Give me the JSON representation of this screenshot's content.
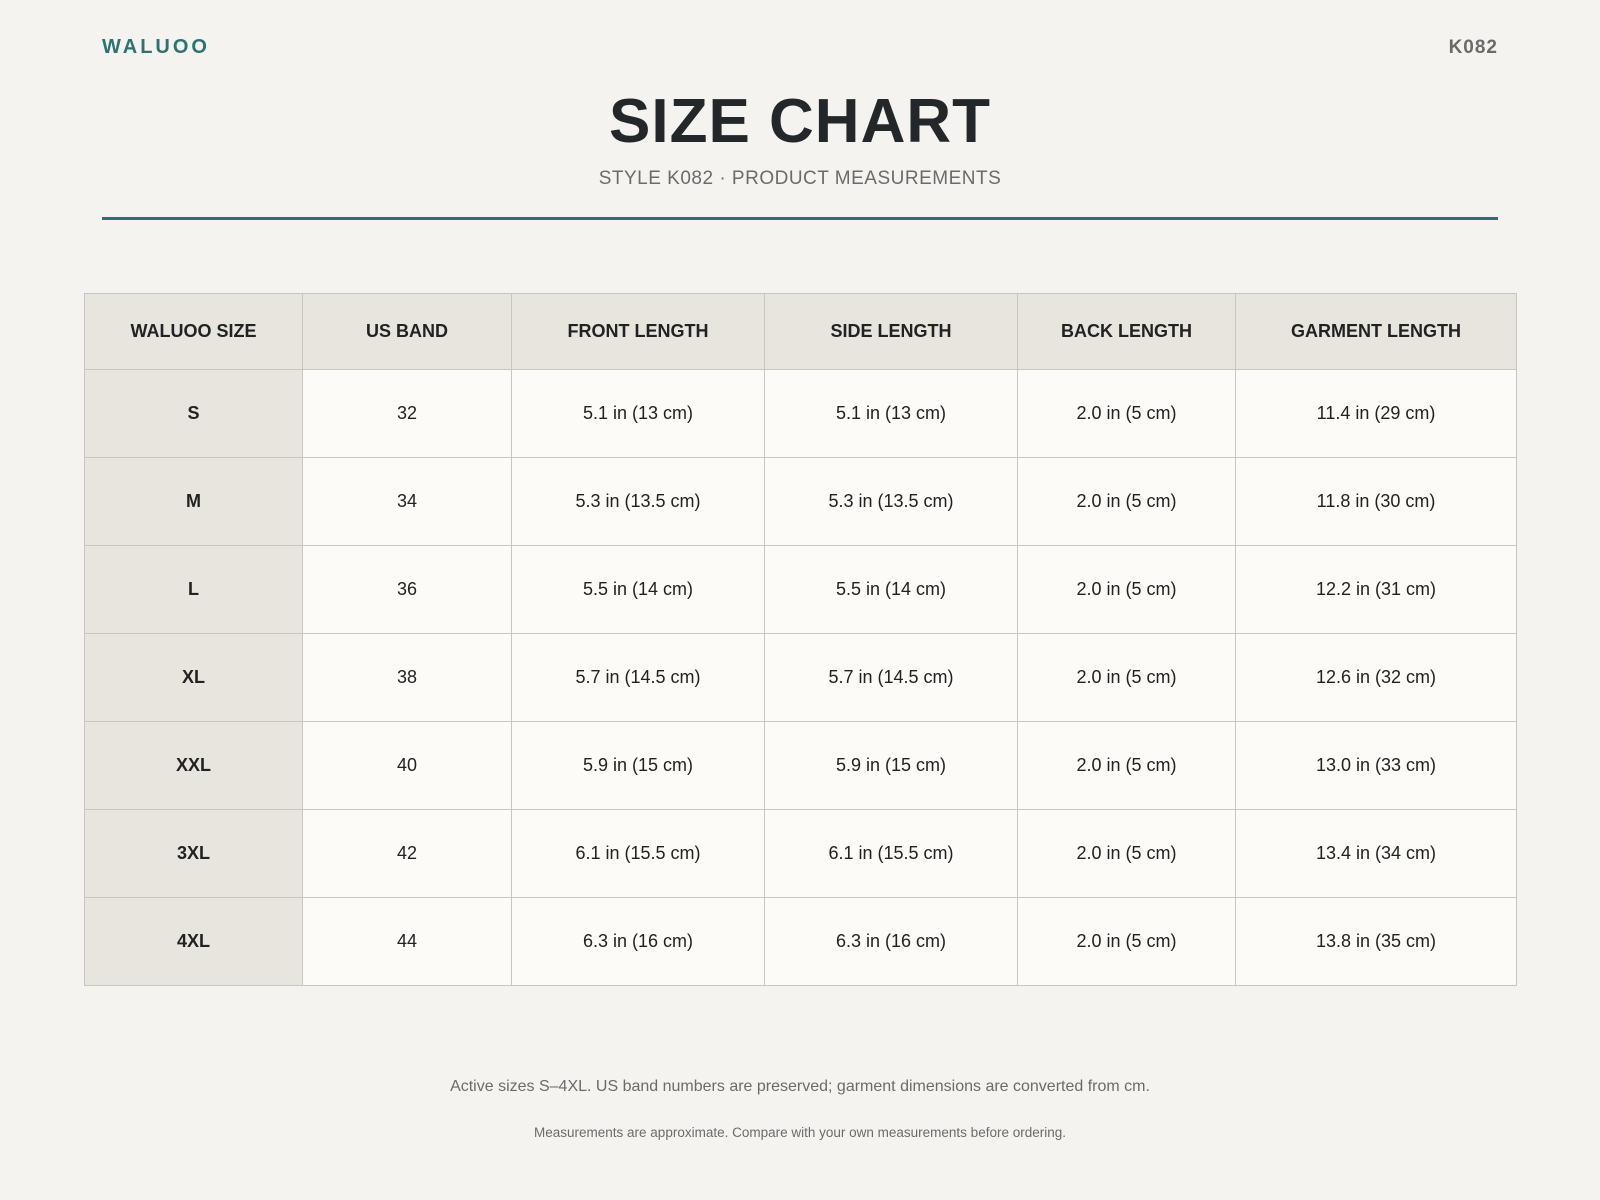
{
  "header": {
    "brand": "WALUOO",
    "code": "K082",
    "title": "SIZE CHART",
    "subtitle": "STYLE K082 · PRODUCT MEASUREMENTS"
  },
  "colors": {
    "accent": "#2f6e6e",
    "background": "#f4f3ef",
    "header_cell": "#e8e5df"
  },
  "table": {
    "columns": [
      "WALUOO SIZE",
      "US BAND",
      "FRONT LENGTH",
      "SIDE LENGTH",
      "BACK LENGTH",
      "GARMENT LENGTH"
    ],
    "rows": [
      [
        "S",
        "32",
        "5.1 in (13 cm)",
        "5.1 in (13 cm)",
        "2.0 in (5 cm)",
        "11.4 in (29 cm)"
      ],
      [
        "M",
        "34",
        "5.3 in (13.5 cm)",
        "5.3 in (13.5 cm)",
        "2.0 in (5 cm)",
        "11.8 in (30 cm)"
      ],
      [
        "L",
        "36",
        "5.5 in (14 cm)",
        "5.5 in (14 cm)",
        "2.0 in (5 cm)",
        "12.2 in (31 cm)"
      ],
      [
        "XL",
        "38",
        "5.7 in (14.5 cm)",
        "5.7 in (14.5 cm)",
        "2.0 in (5 cm)",
        "12.6 in (32 cm)"
      ],
      [
        "XXL",
        "40",
        "5.9 in (15 cm)",
        "5.9 in (15 cm)",
        "2.0 in (5 cm)",
        "13.0 in (33 cm)"
      ],
      [
        "3XL",
        "42",
        "6.1 in (15.5 cm)",
        "6.1 in (15.5 cm)",
        "2.0 in (5 cm)",
        "13.4 in (34 cm)"
      ],
      [
        "4XL",
        "44",
        "6.3 in (16 cm)",
        "6.3 in (16 cm)",
        "2.0 in (5 cm)",
        "13.8 in (35 cm)"
      ]
    ]
  },
  "footer": {
    "note1": "Active sizes S–4XL. US band numbers are preserved; garment dimensions are converted from cm.",
    "note2": "Measurements are approximate. Compare with your own measurements before ordering."
  }
}
